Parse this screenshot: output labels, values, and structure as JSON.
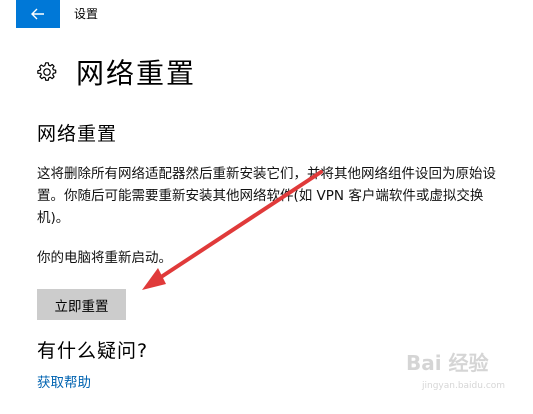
{
  "window": {
    "title": "设置",
    "back_icon": "back-arrow-icon",
    "accent_color": "#0078d7"
  },
  "header": {
    "icon": "gear-icon",
    "title": "网络重置"
  },
  "main": {
    "section_title": "网络重置",
    "description": "这将删除所有网络适配器然后重新安装它们，并将其他网络组件设回为原始设置。你随后可能需要重新安装其他网络软件(如 VPN 客户端软件或虚拟交换机)。",
    "restart_note": "你的电脑将重新启动。",
    "reset_button_label": "立即重置",
    "button_color": "#cccccc"
  },
  "faq": {
    "title": "有什么疑问?",
    "help_link": "获取帮助",
    "link_color": "#0063b1"
  },
  "annotation": {
    "arrow_color": "#e03a3a"
  },
  "watermark": {
    "text": "Bai 经验",
    "subtext": "jingyan.baidu.com"
  }
}
